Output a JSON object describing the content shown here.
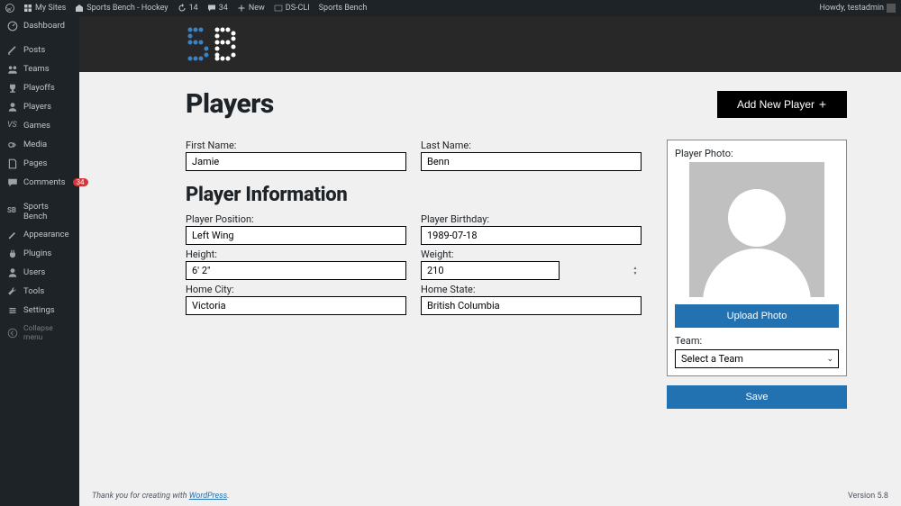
{
  "adminbar": {
    "my_sites": "My Sites",
    "site_name": "Sports Bench - Hockey",
    "updates": "14",
    "comments": "34",
    "new": "New",
    "dscli": "DS-CLI",
    "sports_bench": "Sports Bench",
    "howdy": "Howdy, testadmin"
  },
  "sidebar": {
    "items": [
      {
        "label": "Dashboard"
      },
      {
        "label": "Posts"
      },
      {
        "label": "Teams"
      },
      {
        "label": "Playoffs"
      },
      {
        "label": "Players"
      },
      {
        "label": "Games"
      },
      {
        "label": "Media"
      },
      {
        "label": "Pages"
      },
      {
        "label": "Comments",
        "badge": "34"
      },
      {
        "label": "Sports Bench"
      },
      {
        "label": "Appearance"
      },
      {
        "label": "Plugins"
      },
      {
        "label": "Users"
      },
      {
        "label": "Tools"
      },
      {
        "label": "Settings"
      }
    ],
    "collapse": "Collapse menu"
  },
  "page": {
    "title": "Players",
    "add_button": "Add New Player",
    "section_title": "Player Information"
  },
  "form": {
    "first_name": {
      "label": "First Name:",
      "value": "Jamie"
    },
    "last_name": {
      "label": "Last Name:",
      "value": "Benn"
    },
    "position": {
      "label": "Player Position:",
      "value": "Left Wing"
    },
    "birthday": {
      "label": "Player Birthday:",
      "value": "1989-07-18"
    },
    "height": {
      "label": "Height:",
      "value": "6' 2\""
    },
    "weight": {
      "label": "Weight:",
      "value": "210"
    },
    "home_city": {
      "label": "Home City:",
      "value": "Victoria"
    },
    "home_state": {
      "label": "Home State:",
      "value": "British Columbia"
    }
  },
  "photo": {
    "label": "Player Photo:",
    "upload_button": "Upload Photo",
    "team_label": "Team:",
    "team_select": "Select a Team",
    "save_button": "Save"
  },
  "footer": {
    "thanks_prefix": "Thank you for creating with ",
    "wp": "WordPress",
    "period": ".",
    "version": "Version 5.8"
  }
}
